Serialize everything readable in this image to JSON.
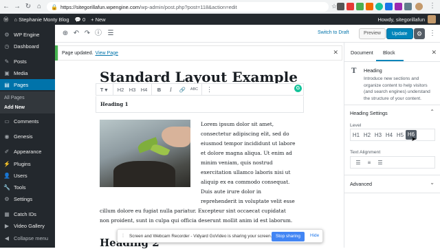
{
  "browser": {
    "url_host": "https://sitegorillafun.wpengine.com",
    "url_path": "/wp-admin/post.php?post=118&action=edit"
  },
  "adminbar": {
    "site_name": "Stephanie Monty Blog",
    "comments_count": "0",
    "new_label": "+ New",
    "howdy": "Howdy, sitegorillafun"
  },
  "sidebar": {
    "items": [
      {
        "label": "WP Engine",
        "icon": "wp-engine-icon"
      },
      {
        "label": "Dashboard",
        "icon": "dashboard-icon"
      },
      {
        "label": "Posts",
        "icon": "pin-icon"
      },
      {
        "label": "Media",
        "icon": "media-icon"
      },
      {
        "label": "Pages",
        "icon": "pages-icon"
      },
      {
        "label": "Comments",
        "icon": "comment-icon"
      },
      {
        "label": "Genesis",
        "icon": "genesis-icon"
      },
      {
        "label": "Appearance",
        "icon": "brush-icon"
      },
      {
        "label": "Plugins",
        "icon": "plugin-icon"
      },
      {
        "label": "Users",
        "icon": "users-icon"
      },
      {
        "label": "Tools",
        "icon": "wrench-icon"
      },
      {
        "label": "Settings",
        "icon": "settings-icon"
      },
      {
        "label": "Catch IDs",
        "icon": "catch-icon"
      },
      {
        "label": "Video Gallery",
        "icon": "video-icon"
      },
      {
        "label": "Collapse menu",
        "icon": "collapse-icon"
      }
    ],
    "sub_items": [
      "All Pages",
      "Add New"
    ]
  },
  "editor": {
    "switch_draft": "Switch to Draft",
    "preview": "Preview",
    "update": "Update"
  },
  "notice": {
    "text": "Page updated.",
    "link": "View Page"
  },
  "content": {
    "title": "Standard Layout Example",
    "heading1": "Heading 1",
    "para_lines": [
      "Lorem ipsum dolor sit amet,",
      "consectetur adipiscing elit, sed do",
      "eiusmod tempor incididunt ut labore",
      "et dolore magna aliqua. Ut enim ad",
      "minim veniam, quis nostrud",
      "exercitation ullamco laboris nisi ut",
      "aliquip ex ea commodo consequat.",
      "Duis aute irure dolor in",
      "reprehenderit in voluptate velit esse"
    ],
    "para_full_lines": [
      "cillum dolore eu fugiat nulla pariatur. Excepteur sint occaecat cupidatat",
      "non proident, sunt in culpa qui officia deserunt mollit anim id est laborum."
    ],
    "heading2": "Heading 2"
  },
  "block_toolbar": {
    "items": [
      "T",
      "H2",
      "H3",
      "H4",
      "B",
      "I",
      "link",
      "ABC",
      "more"
    ]
  },
  "sharebar": {
    "text": "Screen and Webcam Recorder - Vidyard GoVideo is sharing your screen.",
    "stop": "Stop sharing",
    "hide": "Hide"
  },
  "panel": {
    "tab_document": "Document",
    "tab_block": "Block",
    "block_name": "Heading",
    "block_desc": "Introduce new sections and organize content to help visitors (and search engines) understand the structure of your content.",
    "settings_title": "Heading Settings",
    "level_label": "Level",
    "levels": [
      "H1",
      "H2",
      "H3",
      "H4",
      "H5",
      "H6"
    ],
    "selected_level": "H6",
    "alignment_label": "Text Alignment",
    "advanced": "Advanced"
  },
  "colors": {
    "admin_dark": "#23282d",
    "accent_blue": "#0073aa",
    "update_blue": "#0085ba",
    "notice_green": "#46b450"
  }
}
